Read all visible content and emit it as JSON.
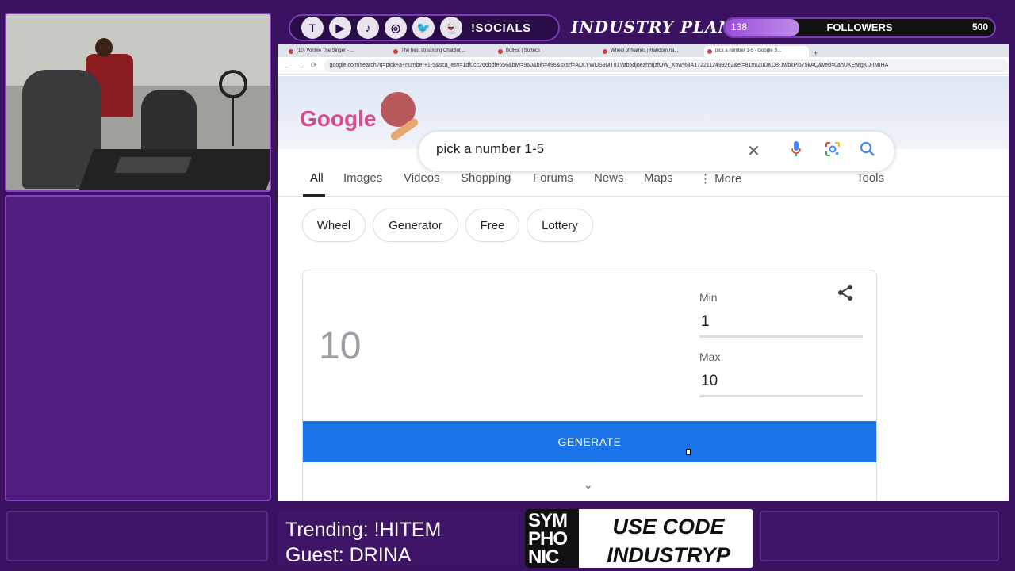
{
  "overlay": {
    "socials_label": "!SOCIALS",
    "social_icons": [
      "twitch-icon",
      "youtube-icon",
      "tiktok-icon",
      "instagram-icon",
      "twitter-icon",
      "snapchat-icon"
    ],
    "channel_name": "INDUSTRY PLANT",
    "followers": {
      "current": "138",
      "label": "FOLLOWERS",
      "goal": "500",
      "progress": 0.276
    },
    "ticker": {
      "trending": "Trending: !HITEM",
      "guest": "Guest: DRINA"
    },
    "sponsor": {
      "logo_lines": [
        "SYM",
        "PHO",
        "NIC"
      ],
      "line1": "USE CODE",
      "line2": "INDUSTRYP"
    }
  },
  "browser": {
    "tabs": [
      {
        "label": "(10) Vontee The Singer - ..."
      },
      {
        "label": "The best streaming ChatBot ..."
      },
      {
        "label": "BotRix | Sortecs"
      },
      {
        "label": "Wheel of Names | Random na..."
      },
      {
        "label": "pick a number 1-5 - Google S..."
      }
    ],
    "new_tab": "+",
    "url": "google.com/search?q=pick+a+number+1-5&sca_esv=1df0cc266bdfe656&biw=960&bih=496&sxsrf=ADLYWIJS9MT81Vab5djoezhhtjzfOW_Xow%3A1722112499262&ei=81mIZuDKD8-1wbkPl675kAQ&ved=0ahUKEwigKD-IMIHA",
    "nav": {
      "back": "←",
      "forward": "→",
      "reload": "⟳"
    }
  },
  "google": {
    "doodle_text": "Google",
    "query": "pick a number 1-5",
    "search_tabs": [
      "All",
      "Images",
      "Videos",
      "Shopping",
      "Forums",
      "News",
      "Maps",
      "⋮ More"
    ],
    "tools": "Tools",
    "chips": [
      "Wheel",
      "Generator",
      "Free",
      "Lottery"
    ]
  },
  "rng": {
    "result": "10",
    "min_label": "Min",
    "min_value": "1",
    "max_label": "Max",
    "max_value": "10",
    "generate_label": "GENERATE",
    "expand_icon": "⌄"
  },
  "colors": {
    "accent": "#1a73e8",
    "overlay_purple": "#4a1a78",
    "frame_purple": "#8a3fc8"
  }
}
